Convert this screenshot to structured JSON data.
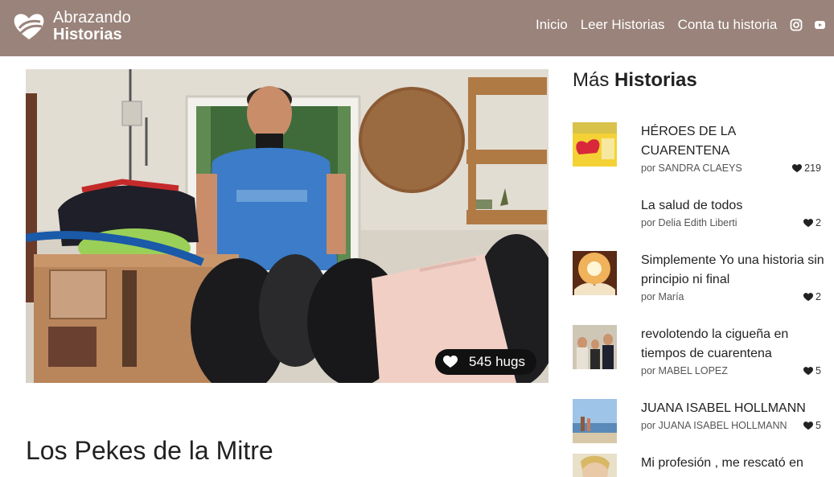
{
  "brand": {
    "line1": "Abrazando",
    "line2": "Historias"
  },
  "nav": {
    "items": [
      {
        "label": "Inicio"
      },
      {
        "label": "Leer Historias"
      },
      {
        "label": "Conta tu historia"
      }
    ],
    "social": [
      "instagram-icon",
      "youtube-icon"
    ]
  },
  "hero": {
    "hugs_label": "545 hugs"
  },
  "story": {
    "title": "Los Pekes de la Mitre"
  },
  "sidebar": {
    "heading_light": "Más",
    "heading_bold": "Historias",
    "items": [
      {
        "title": "HÉROES DE LA CUARENTENA",
        "author": "por SANDRA CLAEYS",
        "likes": "219"
      },
      {
        "title": "La salud de todos",
        "author": "por Delia Edith Liberti",
        "likes": "2"
      },
      {
        "title": "Simplemente Yo una historia sin principio ni final",
        "author": "por María",
        "likes": "2"
      },
      {
        "title": "revolotendo la cigueña en tiempos de cuarentena",
        "author": "por MABEL LOPEZ",
        "likes": "5"
      },
      {
        "title": "JUANA ISABEL HOLLMANN",
        "author": "por JUANA ISABEL HOLLMANN",
        "likes": "5"
      },
      {
        "title": "Mi profesión , me rescató en",
        "author": "",
        "likes": ""
      }
    ]
  },
  "colors": {
    "header_bg": "#99837a",
    "pill_bg": "#111111"
  }
}
